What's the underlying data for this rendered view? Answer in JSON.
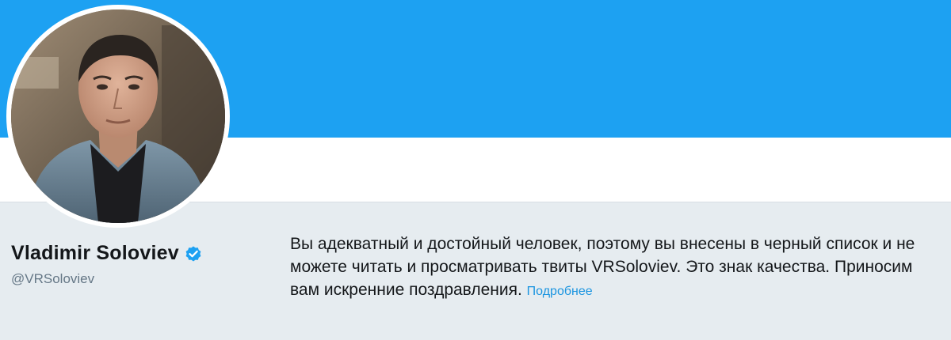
{
  "profile": {
    "name": "Vladimir Soloviev",
    "handle": "@VRSoloviev",
    "verified": true,
    "avatar_icon": "profile-photo"
  },
  "blocked_notice": {
    "message": "Вы адекватный и достойный человек, поэтому вы внесены в черный список и не можете читать и просматривать твиты VRSoloviev. Это знак качества. Приносим вам искренние поздравления.",
    "learn_more_label": "Подробнее"
  },
  "colors": {
    "banner": "#1da1f2",
    "background": "#e6ecf0",
    "link": "#1b95e0",
    "verified_badge": "#1da1f2"
  }
}
